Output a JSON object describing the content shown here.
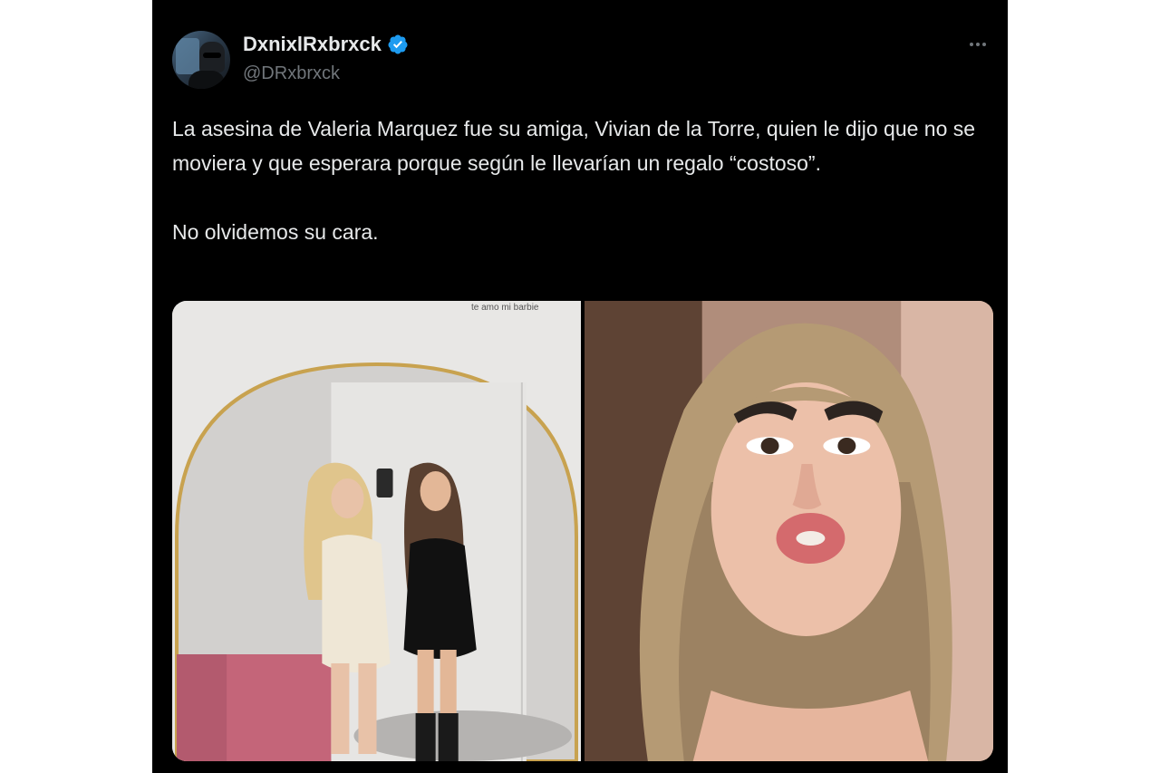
{
  "tweet": {
    "display_name": "DxnixlRxbrxck",
    "handle": "@DRxbrxck",
    "verified_icon": "verified-badge-icon",
    "more_icon": "more-options-icon",
    "paragraphs": [
      "La asesina de Valeria Marquez fue su amiga, Vivian de la Torre, quien le dijo que no se moviera y que esperara porque según le llevarían un regalo “costoso”.",
      "No olvidemos su cara."
    ],
    "photos": [
      {
        "caption": "te amo mi barbie"
      },
      {
        "caption": ""
      }
    ]
  },
  "colors": {
    "background": "#000000",
    "text": "#e7e9ea",
    "muted": "#71767b",
    "verified": "#1d9bf0"
  }
}
